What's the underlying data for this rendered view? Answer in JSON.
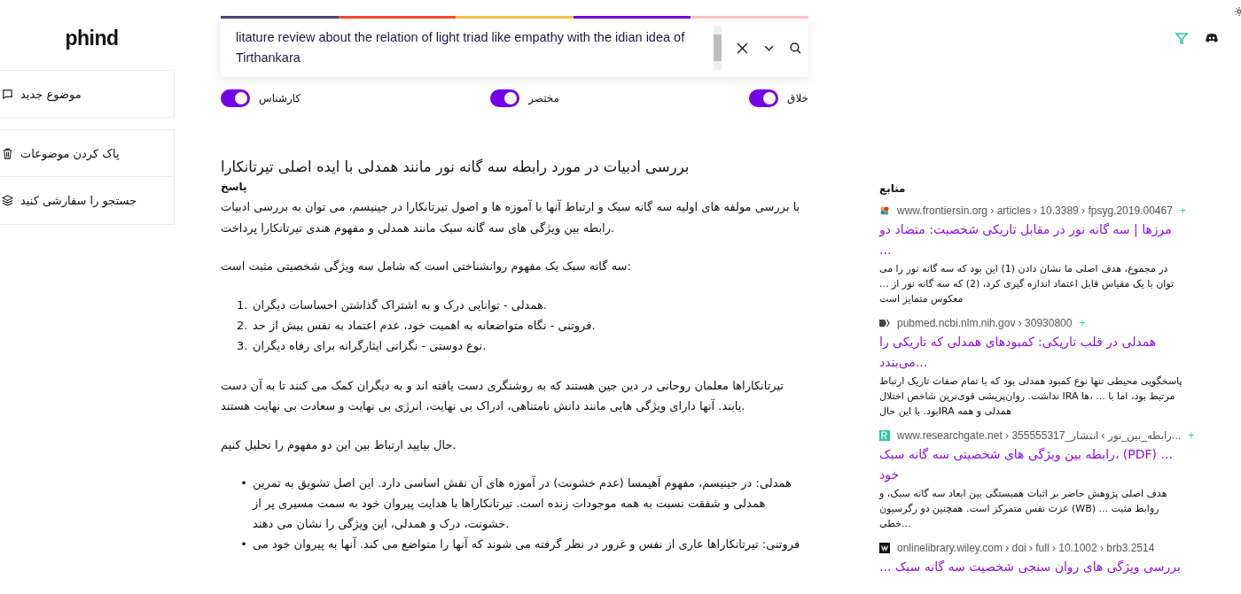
{
  "logo": "phind",
  "sidebar": {
    "items": [
      {
        "label": "موضوع جدید"
      },
      {
        "label": "پاک کردن موضوعات"
      },
      {
        "label": "جستجو را سفارشی کنید"
      }
    ]
  },
  "search": {
    "value": "litature review about the relation of light triad like empathy with the idian idea of Tirthankara"
  },
  "toggles": [
    {
      "label": "خلاق",
      "on": true
    },
    {
      "label": "مختصر",
      "on": true
    },
    {
      "label": "کارشناس",
      "on": true
    }
  ],
  "answer": {
    "title": "بررسی ادبیات در مورد رابطه سه گانه نور مانند همدلی با ایده اصلی تیرتانکارا",
    "heading": "پاسخ",
    "blocks": [
      {
        "kind": "paragraph",
        "text": "با بررسی مولفه های اولیه سه گانه سبک و ارتباط آنها با آموزه ها و اصول تیرتانکارا در جینیسم، می توان به بررسی ادبیات رابطه بین ویژگی های سه گانه سبک مانند همدلی و مفهوم هندی تیرتانکارا پرداخت."
      },
      {
        "kind": "paragraph",
        "text": "سه گانه سبک یک مفهوم روانشناختی است که شامل سه ویژگی شخصیتی مثبت است:"
      },
      {
        "kind": "list",
        "items": [
          {
            "marker": "1.",
            "text": "همدلی - توانایی درک و به اشتراک گذاشتن احساسات دیگران."
          },
          {
            "marker": "2.",
            "text": "فروتنی - نگاه متواضعانه به اهمیت خود، عدم اعتماد به نفس بیش از حد."
          },
          {
            "marker": "3.",
            "text": "نوع دوستی - نگرانی ایثارگرانه برای رفاه دیگران."
          }
        ]
      },
      {
        "kind": "paragraph",
        "text": "تیرتانکاراها معلمان روحانی در دین جین هستند که به روشنگری دست یافته اند و به دیگران کمک می کنند تا به آن دست یابند. آنها دارای ویژگی هایی مانند دانش نامتناهی، ادراک بی نهایت، انرژی بی نهایت و سعادت بی نهایت هستند."
      },
      {
        "kind": "paragraph",
        "text": "حال بیایید ارتباط بین این دو مفهوم را تحلیل کنیم."
      },
      {
        "kind": "list",
        "items": [
          {
            "marker": "•",
            "text": "همدلی: در جینیسم، مفهوم آهیمسا (عدم خشونت) در آموزه های آن نقش اساسی دارد. این اصل تشویق به تمرین همدلی و شفقت نسبت به همه موجودات زنده است. تیرتانکاراها با هدایت پیروان خود به سمت مسیری پر از خشونت، درک و همدلی، این ویژگی را نشان می دهند."
          },
          {
            "marker": "•",
            "text": "فروتنی: تیرتانکاراها عاری از نفس و غرور در نظر گرفته می شوند که آنها را متواضع می کند. آنها به پیروان خود می"
          }
        ]
      }
    ]
  },
  "sources": {
    "heading": "منابع",
    "items": [
      {
        "kind": "frontiers",
        "url": "www.frontiersin.org › articles › 10.3389 › fpsyg.2019.00467",
        "add": "+",
        "title": "مرزها | سه گانه نور در مقابل تاریکی شخصیت: متضاد دو ...",
        "snippet": "در مجموع، هدف اصلی ما نشان دادن (1) این بود که سه گانه نور را می توان با یک مقیاس قابل اعتماد اندازه گیری کرد، (2) که سه گانه نور از ... معکوس متمایز است"
      },
      {
        "kind": "pubmed",
        "url": "pubmed.ncbi.nlm.nih.gov › 30930800",
        "add": "+",
        "title": "همدلی در قلب تاریکی: کمبودهای همدلی که تاریکی را می‌بندد...",
        "snippet": "پاسخگویی محیطی تنها نوع کمبود همدلی بود که با تمام صفات تاریک ارتباط نداشت. روان‌پریشی قوی‌ترین شاخص اختلال IRA مرتبط بود، اما با ... ،ها بود. با این حالIRA همدلی و همه"
      },
      {
        "kind": "researchgate",
        "url": "www.researchgate.net › 355555317_رابطه_بین_نور › انتشار...",
        "add": "+",
        "title": "رابطه بین ویژگی های شخصیتی سه گانه سبک، (PDF) ... خود",
        "snippet": "هدف اصلی پژوهش حاضر بر اثبات همبستگی بین ابعاد سه گانه سبک، و عزت نفس متمرکز است. همچنین دو رگرسیون (WB) روابط مثبت ... ...خطی"
      },
      {
        "kind": "wiley",
        "url": "onlinelibrary.wiley.com › doi › full › 10.1002 › brb3.2514",
        "title": "... بررسی ویژگی های روان سنجی شخصیت سه گانه سبک"
      }
    ]
  }
}
